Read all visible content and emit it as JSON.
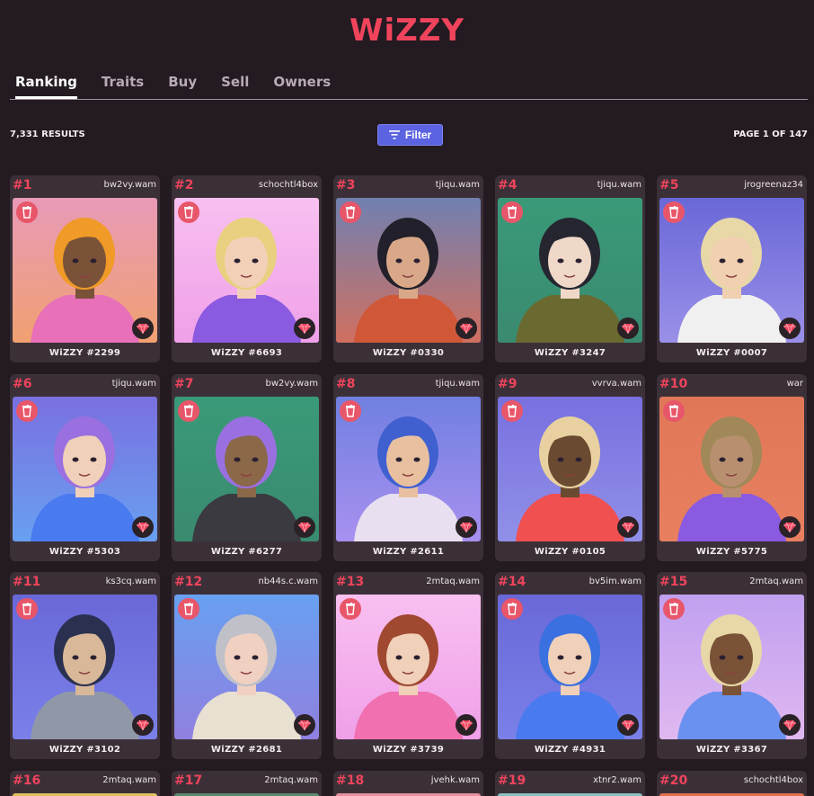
{
  "header": {
    "logo": "WiZZY"
  },
  "tabs": [
    {
      "label": "Ranking",
      "active": true
    },
    {
      "label": "Traits",
      "active": false
    },
    {
      "label": "Buy",
      "active": false
    },
    {
      "label": "Sell",
      "active": false
    },
    {
      "label": "Owners",
      "active": false
    }
  ],
  "toolbar": {
    "results": "7,331 RESULTS",
    "filter_label": "Filter",
    "page_info": "PAGE 1 OF 147"
  },
  "colors": {
    "background": "#241a22",
    "accent": "#f0445c",
    "filter_button": "#5b63e0",
    "card": "#3c3038"
  },
  "cards": [
    {
      "rank": "#1",
      "owner": "bw2vy.wam",
      "name": "WiZZY #2299",
      "bg": [
        "#e89ab8",
        "#f0a070"
      ],
      "skin": "#7a5238",
      "hair": "#f09a28",
      "shirt": "#e870b8"
    },
    {
      "rank": "#2",
      "owner": "schochtl4box",
      "name": "WiZZY #6693",
      "bg": [
        "#f8c0f0",
        "#f0a0e8"
      ],
      "skin": "#f2d0b8",
      "hair": "#e8d080",
      "shirt": "#8a5ae0"
    },
    {
      "rank": "#3",
      "owner": "tjiqu.wam",
      "name": "WiZZY #0330",
      "bg": [
        "#7080b0",
        "#d07060"
      ],
      "skin": "#d8a888",
      "hair": "#22202a",
      "shirt": "#d05838"
    },
    {
      "rank": "#4",
      "owner": "tjiqu.wam",
      "name": "WiZZY #3247",
      "bg": [
        "#3a9a78",
        "#3a8a70"
      ],
      "skin": "#f0d8c8",
      "hair": "#262630",
      "shirt": "#6a6a30"
    },
    {
      "rank": "#5",
      "owner": "jrogreenaz34",
      "name": "WiZZY #0007",
      "bg": [
        "#6a68d8",
        "#9a90e8"
      ],
      "skin": "#f0d0b0",
      "hair": "#e8d8a8",
      "shirt": "#f0f0f0"
    },
    {
      "rank": "#6",
      "owner": "tjiqu.wam",
      "name": "WiZZY #5303",
      "bg": [
        "#7a70e0",
        "#68a0f0"
      ],
      "skin": "#f0d0b8",
      "hair": "#9a70e0",
      "shirt": "#4a7af0"
    },
    {
      "rank": "#7",
      "owner": "bw2vy.wam",
      "name": "WiZZY #6277",
      "bg": [
        "#3a9a78",
        "#3a8a70"
      ],
      "skin": "#8a6848",
      "hair": "#9a70e0",
      "shirt": "#3a3a40"
    },
    {
      "rank": "#8",
      "owner": "tjiqu.wam",
      "name": "WiZZY #2611",
      "bg": [
        "#7080e0",
        "#a890f0"
      ],
      "skin": "#e8c0a0",
      "hair": "#4060d0",
      "shirt": "#e8e0f0"
    },
    {
      "rank": "#9",
      "owner": "vvrva.wam",
      "name": "WiZZY #0105",
      "bg": [
        "#7870e0",
        "#9090e8"
      ],
      "skin": "#6a4a30",
      "hair": "#e8d0a0",
      "shirt": "#f05050"
    },
    {
      "rank": "#10",
      "owner": "war",
      "name": "WiZZY #5775",
      "bg": [
        "#e07858",
        "#e88060"
      ],
      "skin": "#b89070",
      "hair": "#a08858",
      "shirt": "#8a5ae0"
    },
    {
      "rank": "#11",
      "owner": "ks3cq.wam",
      "name": "WiZZY #3102",
      "bg": [
        "#6a68d8",
        "#7a80e8"
      ],
      "skin": "#d8b898",
      "hair": "#2a3050",
      "shirt": "#9098a8"
    },
    {
      "rank": "#12",
      "owner": "nb44s.c.wam",
      "name": "WiZZY #2681",
      "bg": [
        "#68a0f0",
        "#9080e0"
      ],
      "skin": "#f0d0c0",
      "hair": "#c0c0c8",
      "shirt": "#e8e0d0"
    },
    {
      "rank": "#13",
      "owner": "2mtaq.wam",
      "name": "WiZZY #3739",
      "bg": [
        "#f8c0f0",
        "#f0a0e8"
      ],
      "skin": "#f0d0b8",
      "hair": "#a04830",
      "shirt": "#f070b0"
    },
    {
      "rank": "#14",
      "owner": "bv5im.wam",
      "name": "WiZZY #4931",
      "bg": [
        "#6a68d8",
        "#7a80e8"
      ],
      "skin": "#f0d0b8",
      "hair": "#3a70e0",
      "shirt": "#4a7af0"
    },
    {
      "rank": "#15",
      "owner": "2mtaq.wam",
      "name": "WiZZY #3367",
      "bg": [
        "#c0a0f0",
        "#e0b8f0"
      ],
      "skin": "#7a5238",
      "hair": "#e8d8a8",
      "shirt": "#6a90f0"
    },
    {
      "rank": "#16",
      "owner": "2mtaq.wam"
    },
    {
      "rank": "#17",
      "owner": "2mtaq.wam"
    },
    {
      "rank": "#18",
      "owner": "jvehk.wam"
    },
    {
      "rank": "#19",
      "owner": "xtnr2.wam"
    },
    {
      "rank": "#20",
      "owner": "schochtl4box"
    }
  ]
}
